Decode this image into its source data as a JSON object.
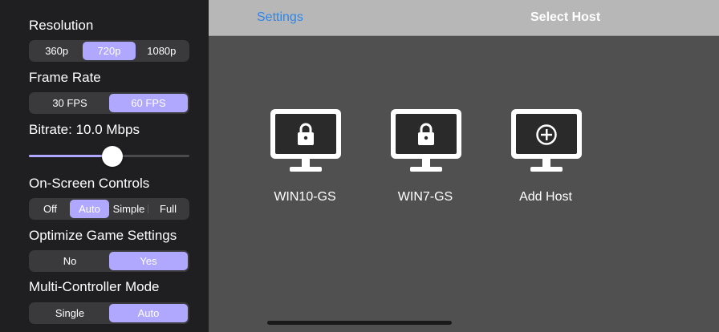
{
  "sidebar": {
    "resolution": {
      "label": "Resolution",
      "options": [
        "360p",
        "720p",
        "1080p"
      ],
      "selected": "720p"
    },
    "frame_rate": {
      "label": "Frame Rate",
      "options": [
        "30 FPS",
        "60 FPS"
      ],
      "selected": "60 FPS"
    },
    "bitrate": {
      "label": "Bitrate: 10.0 Mbps",
      "level_fraction": 0.52
    },
    "onscreen_controls": {
      "label": "On-Screen Controls",
      "options": [
        "Off",
        "Auto",
        "Simple",
        "Full"
      ],
      "selected": "Auto"
    },
    "optimize_game_settings": {
      "label": "Optimize Game Settings",
      "options": [
        "No",
        "Yes"
      ],
      "selected": "Yes"
    },
    "multi_controller": {
      "label": "Multi-Controller Mode",
      "options": [
        "Single",
        "Auto"
      ],
      "selected": "Auto"
    }
  },
  "navbar": {
    "settings_label": "Settings",
    "title": "Select Host"
  },
  "hosts": [
    {
      "name": "WIN10-GS",
      "icon": "lock-icon"
    },
    {
      "name": "WIN7-GS",
      "icon": "lock-icon"
    },
    {
      "name": "Add Host",
      "icon": "plus-circle-icon"
    }
  ],
  "colors": {
    "accent": "#b0a8ff",
    "link": "#2f86e8",
    "sidebar_bg": "#1f1f22",
    "main_bg": "#505050"
  }
}
